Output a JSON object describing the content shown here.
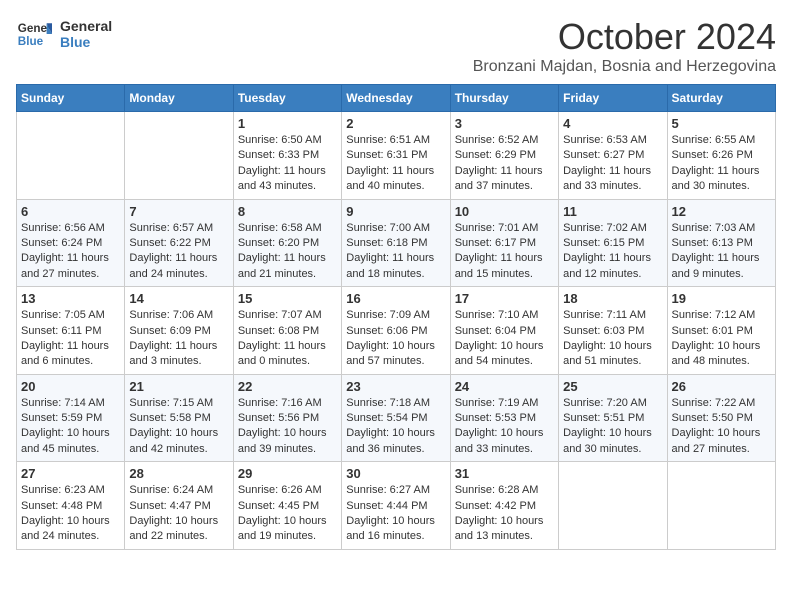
{
  "header": {
    "logo_line1": "General",
    "logo_line2": "Blue",
    "month": "October 2024",
    "location": "Bronzani Majdan, Bosnia and Herzegovina"
  },
  "weekdays": [
    "Sunday",
    "Monday",
    "Tuesday",
    "Wednesday",
    "Thursday",
    "Friday",
    "Saturday"
  ],
  "weeks": [
    [
      {
        "day": "",
        "info": ""
      },
      {
        "day": "",
        "info": ""
      },
      {
        "day": "1",
        "info": "Sunrise: 6:50 AM\nSunset: 6:33 PM\nDaylight: 11 hours and 43 minutes."
      },
      {
        "day": "2",
        "info": "Sunrise: 6:51 AM\nSunset: 6:31 PM\nDaylight: 11 hours and 40 minutes."
      },
      {
        "day": "3",
        "info": "Sunrise: 6:52 AM\nSunset: 6:29 PM\nDaylight: 11 hours and 37 minutes."
      },
      {
        "day": "4",
        "info": "Sunrise: 6:53 AM\nSunset: 6:27 PM\nDaylight: 11 hours and 33 minutes."
      },
      {
        "day": "5",
        "info": "Sunrise: 6:55 AM\nSunset: 6:26 PM\nDaylight: 11 hours and 30 minutes."
      }
    ],
    [
      {
        "day": "6",
        "info": "Sunrise: 6:56 AM\nSunset: 6:24 PM\nDaylight: 11 hours and 27 minutes."
      },
      {
        "day": "7",
        "info": "Sunrise: 6:57 AM\nSunset: 6:22 PM\nDaylight: 11 hours and 24 minutes."
      },
      {
        "day": "8",
        "info": "Sunrise: 6:58 AM\nSunset: 6:20 PM\nDaylight: 11 hours and 21 minutes."
      },
      {
        "day": "9",
        "info": "Sunrise: 7:00 AM\nSunset: 6:18 PM\nDaylight: 11 hours and 18 minutes."
      },
      {
        "day": "10",
        "info": "Sunrise: 7:01 AM\nSunset: 6:17 PM\nDaylight: 11 hours and 15 minutes."
      },
      {
        "day": "11",
        "info": "Sunrise: 7:02 AM\nSunset: 6:15 PM\nDaylight: 11 hours and 12 minutes."
      },
      {
        "day": "12",
        "info": "Sunrise: 7:03 AM\nSunset: 6:13 PM\nDaylight: 11 hours and 9 minutes."
      }
    ],
    [
      {
        "day": "13",
        "info": "Sunrise: 7:05 AM\nSunset: 6:11 PM\nDaylight: 11 hours and 6 minutes."
      },
      {
        "day": "14",
        "info": "Sunrise: 7:06 AM\nSunset: 6:09 PM\nDaylight: 11 hours and 3 minutes."
      },
      {
        "day": "15",
        "info": "Sunrise: 7:07 AM\nSunset: 6:08 PM\nDaylight: 11 hours and 0 minutes."
      },
      {
        "day": "16",
        "info": "Sunrise: 7:09 AM\nSunset: 6:06 PM\nDaylight: 10 hours and 57 minutes."
      },
      {
        "day": "17",
        "info": "Sunrise: 7:10 AM\nSunset: 6:04 PM\nDaylight: 10 hours and 54 minutes."
      },
      {
        "day": "18",
        "info": "Sunrise: 7:11 AM\nSunset: 6:03 PM\nDaylight: 10 hours and 51 minutes."
      },
      {
        "day": "19",
        "info": "Sunrise: 7:12 AM\nSunset: 6:01 PM\nDaylight: 10 hours and 48 minutes."
      }
    ],
    [
      {
        "day": "20",
        "info": "Sunrise: 7:14 AM\nSunset: 5:59 PM\nDaylight: 10 hours and 45 minutes."
      },
      {
        "day": "21",
        "info": "Sunrise: 7:15 AM\nSunset: 5:58 PM\nDaylight: 10 hours and 42 minutes."
      },
      {
        "day": "22",
        "info": "Sunrise: 7:16 AM\nSunset: 5:56 PM\nDaylight: 10 hours and 39 minutes."
      },
      {
        "day": "23",
        "info": "Sunrise: 7:18 AM\nSunset: 5:54 PM\nDaylight: 10 hours and 36 minutes."
      },
      {
        "day": "24",
        "info": "Sunrise: 7:19 AM\nSunset: 5:53 PM\nDaylight: 10 hours and 33 minutes."
      },
      {
        "day": "25",
        "info": "Sunrise: 7:20 AM\nSunset: 5:51 PM\nDaylight: 10 hours and 30 minutes."
      },
      {
        "day": "26",
        "info": "Sunrise: 7:22 AM\nSunset: 5:50 PM\nDaylight: 10 hours and 27 minutes."
      }
    ],
    [
      {
        "day": "27",
        "info": "Sunrise: 6:23 AM\nSunset: 4:48 PM\nDaylight: 10 hours and 24 minutes."
      },
      {
        "day": "28",
        "info": "Sunrise: 6:24 AM\nSunset: 4:47 PM\nDaylight: 10 hours and 22 minutes."
      },
      {
        "day": "29",
        "info": "Sunrise: 6:26 AM\nSunset: 4:45 PM\nDaylight: 10 hours and 19 minutes."
      },
      {
        "day": "30",
        "info": "Sunrise: 6:27 AM\nSunset: 4:44 PM\nDaylight: 10 hours and 16 minutes."
      },
      {
        "day": "31",
        "info": "Sunrise: 6:28 AM\nSunset: 4:42 PM\nDaylight: 10 hours and 13 minutes."
      },
      {
        "day": "",
        "info": ""
      },
      {
        "day": "",
        "info": ""
      }
    ]
  ]
}
